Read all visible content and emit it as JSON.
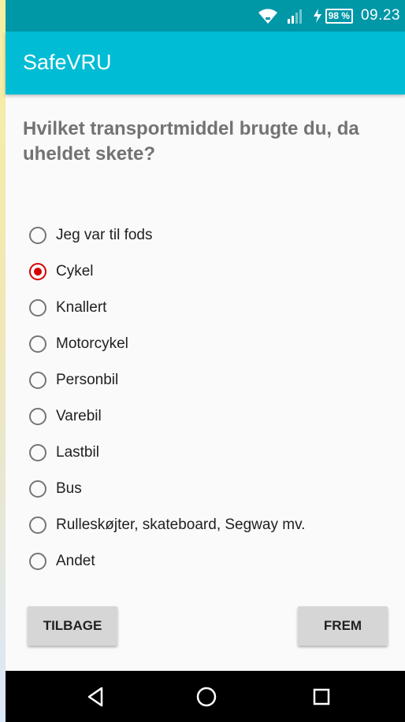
{
  "status_bar": {
    "battery": "98 %",
    "time": "09.23",
    "icons": [
      "wifi-icon",
      "signal-icon",
      "charging-icon",
      "battery-icon"
    ]
  },
  "app": {
    "title": "SafeVRU"
  },
  "question": {
    "text": "Hvilket transportmiddel brugte du, da uheldet skete?",
    "options": [
      {
        "label": "Jeg var til fods",
        "checked": false
      },
      {
        "label": "Cykel",
        "checked": true
      },
      {
        "label": "Knallert",
        "checked": false
      },
      {
        "label": "Motorcykel",
        "checked": false
      },
      {
        "label": "Personbil",
        "checked": false
      },
      {
        "label": "Varebil",
        "checked": false
      },
      {
        "label": "Lastbil",
        "checked": false
      },
      {
        "label": "Bus",
        "checked": false
      },
      {
        "label": "Rulleskøjter, skateboard, Segway mv.",
        "checked": false
      },
      {
        "label": "Andet",
        "checked": false
      }
    ]
  },
  "buttons": {
    "back": "TILBAGE",
    "next": "FREM"
  },
  "nav": {
    "icons": [
      "back-icon",
      "home-icon",
      "recents-icon"
    ]
  },
  "colors": {
    "status_bar": "#0097a7",
    "app_bar": "#00bcd4",
    "radio_checked": "#d50000"
  }
}
